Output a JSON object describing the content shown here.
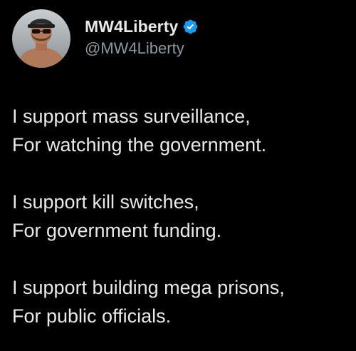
{
  "author": {
    "display_name": "MW4Liberty",
    "handle": "@MW4Liberty",
    "verified_icon": "verified-badge-icon",
    "verified_color": "#1d9bf0"
  },
  "tweet": {
    "paragraphs": [
      {
        "line1": "I support mass surveillance,",
        "line2": "For watching the government."
      },
      {
        "line1": "I support kill switches,",
        "line2": "For government funding."
      },
      {
        "line1": "I support building mega prisons,",
        "line2": "For public officials."
      }
    ]
  },
  "colors": {
    "background": "#000000",
    "text": "#e7e9ea",
    "secondary_text": "#8b98a5"
  }
}
